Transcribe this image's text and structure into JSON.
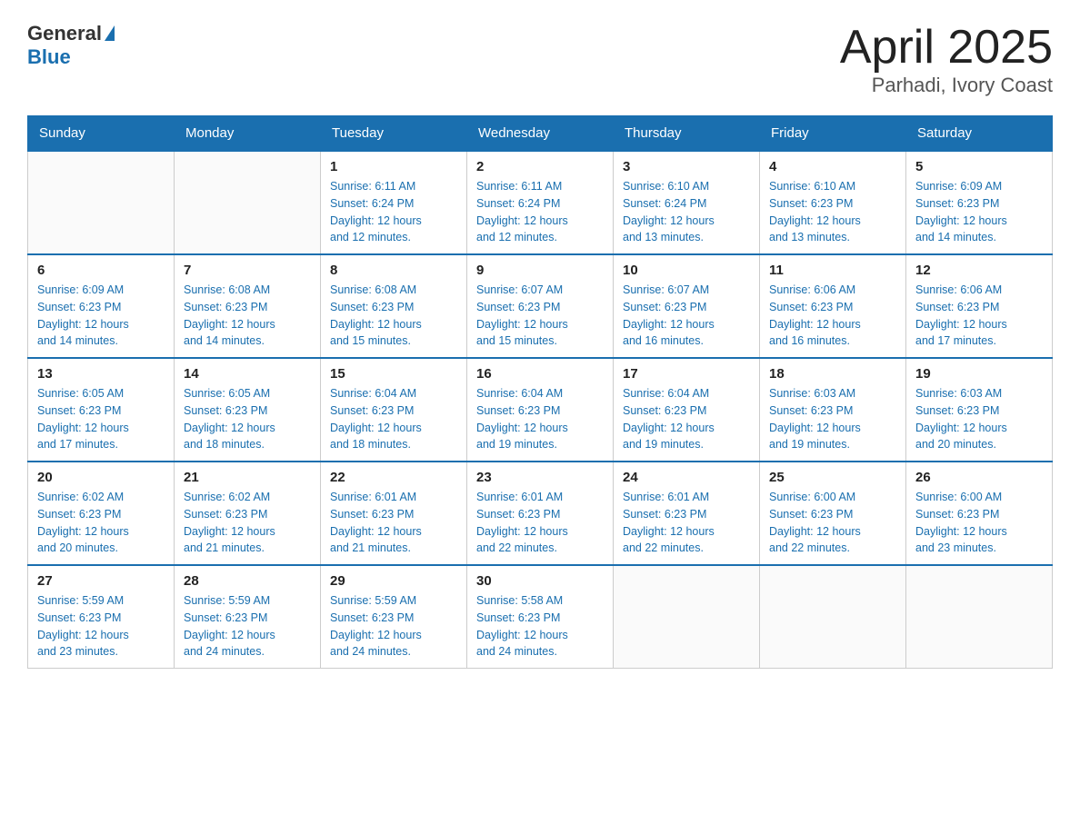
{
  "logo": {
    "general": "General",
    "blue": "Blue"
  },
  "title": "April 2025",
  "subtitle": "Parhadi, Ivory Coast",
  "weekdays": [
    "Sunday",
    "Monday",
    "Tuesday",
    "Wednesday",
    "Thursday",
    "Friday",
    "Saturday"
  ],
  "weeks": [
    [
      {
        "day": "",
        "info": ""
      },
      {
        "day": "",
        "info": ""
      },
      {
        "day": "1",
        "info": "Sunrise: 6:11 AM\nSunset: 6:24 PM\nDaylight: 12 hours\nand 12 minutes."
      },
      {
        "day": "2",
        "info": "Sunrise: 6:11 AM\nSunset: 6:24 PM\nDaylight: 12 hours\nand 12 minutes."
      },
      {
        "day": "3",
        "info": "Sunrise: 6:10 AM\nSunset: 6:24 PM\nDaylight: 12 hours\nand 13 minutes."
      },
      {
        "day": "4",
        "info": "Sunrise: 6:10 AM\nSunset: 6:23 PM\nDaylight: 12 hours\nand 13 minutes."
      },
      {
        "day": "5",
        "info": "Sunrise: 6:09 AM\nSunset: 6:23 PM\nDaylight: 12 hours\nand 14 minutes."
      }
    ],
    [
      {
        "day": "6",
        "info": "Sunrise: 6:09 AM\nSunset: 6:23 PM\nDaylight: 12 hours\nand 14 minutes."
      },
      {
        "day": "7",
        "info": "Sunrise: 6:08 AM\nSunset: 6:23 PM\nDaylight: 12 hours\nand 14 minutes."
      },
      {
        "day": "8",
        "info": "Sunrise: 6:08 AM\nSunset: 6:23 PM\nDaylight: 12 hours\nand 15 minutes."
      },
      {
        "day": "9",
        "info": "Sunrise: 6:07 AM\nSunset: 6:23 PM\nDaylight: 12 hours\nand 15 minutes."
      },
      {
        "day": "10",
        "info": "Sunrise: 6:07 AM\nSunset: 6:23 PM\nDaylight: 12 hours\nand 16 minutes."
      },
      {
        "day": "11",
        "info": "Sunrise: 6:06 AM\nSunset: 6:23 PM\nDaylight: 12 hours\nand 16 minutes."
      },
      {
        "day": "12",
        "info": "Sunrise: 6:06 AM\nSunset: 6:23 PM\nDaylight: 12 hours\nand 17 minutes."
      }
    ],
    [
      {
        "day": "13",
        "info": "Sunrise: 6:05 AM\nSunset: 6:23 PM\nDaylight: 12 hours\nand 17 minutes."
      },
      {
        "day": "14",
        "info": "Sunrise: 6:05 AM\nSunset: 6:23 PM\nDaylight: 12 hours\nand 18 minutes."
      },
      {
        "day": "15",
        "info": "Sunrise: 6:04 AM\nSunset: 6:23 PM\nDaylight: 12 hours\nand 18 minutes."
      },
      {
        "day": "16",
        "info": "Sunrise: 6:04 AM\nSunset: 6:23 PM\nDaylight: 12 hours\nand 19 minutes."
      },
      {
        "day": "17",
        "info": "Sunrise: 6:04 AM\nSunset: 6:23 PM\nDaylight: 12 hours\nand 19 minutes."
      },
      {
        "day": "18",
        "info": "Sunrise: 6:03 AM\nSunset: 6:23 PM\nDaylight: 12 hours\nand 19 minutes."
      },
      {
        "day": "19",
        "info": "Sunrise: 6:03 AM\nSunset: 6:23 PM\nDaylight: 12 hours\nand 20 minutes."
      }
    ],
    [
      {
        "day": "20",
        "info": "Sunrise: 6:02 AM\nSunset: 6:23 PM\nDaylight: 12 hours\nand 20 minutes."
      },
      {
        "day": "21",
        "info": "Sunrise: 6:02 AM\nSunset: 6:23 PM\nDaylight: 12 hours\nand 21 minutes."
      },
      {
        "day": "22",
        "info": "Sunrise: 6:01 AM\nSunset: 6:23 PM\nDaylight: 12 hours\nand 21 minutes."
      },
      {
        "day": "23",
        "info": "Sunrise: 6:01 AM\nSunset: 6:23 PM\nDaylight: 12 hours\nand 22 minutes."
      },
      {
        "day": "24",
        "info": "Sunrise: 6:01 AM\nSunset: 6:23 PM\nDaylight: 12 hours\nand 22 minutes."
      },
      {
        "day": "25",
        "info": "Sunrise: 6:00 AM\nSunset: 6:23 PM\nDaylight: 12 hours\nand 22 minutes."
      },
      {
        "day": "26",
        "info": "Sunrise: 6:00 AM\nSunset: 6:23 PM\nDaylight: 12 hours\nand 23 minutes."
      }
    ],
    [
      {
        "day": "27",
        "info": "Sunrise: 5:59 AM\nSunset: 6:23 PM\nDaylight: 12 hours\nand 23 minutes."
      },
      {
        "day": "28",
        "info": "Sunrise: 5:59 AM\nSunset: 6:23 PM\nDaylight: 12 hours\nand 24 minutes."
      },
      {
        "day": "29",
        "info": "Sunrise: 5:59 AM\nSunset: 6:23 PM\nDaylight: 12 hours\nand 24 minutes."
      },
      {
        "day": "30",
        "info": "Sunrise: 5:58 AM\nSunset: 6:23 PM\nDaylight: 12 hours\nand 24 minutes."
      },
      {
        "day": "",
        "info": ""
      },
      {
        "day": "",
        "info": ""
      },
      {
        "day": "",
        "info": ""
      }
    ]
  ]
}
